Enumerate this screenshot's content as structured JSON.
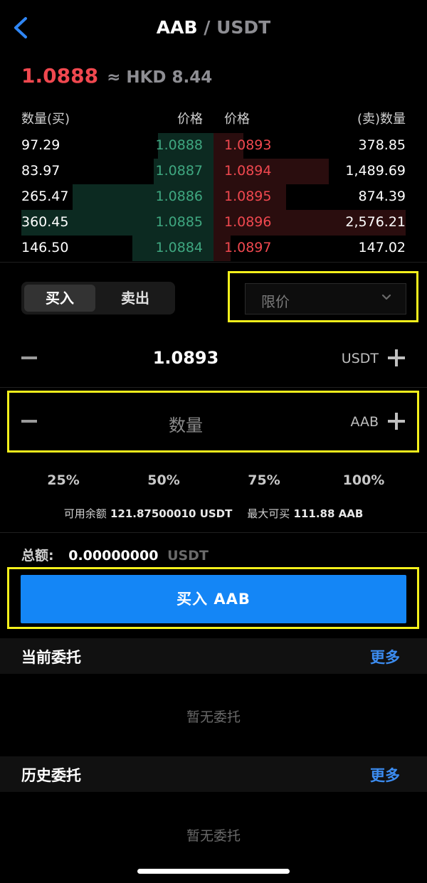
{
  "header": {
    "base": "AAB",
    "quote": "/ USDT"
  },
  "ticker": {
    "last_price": "1.0888",
    "approx": "≈ HKD 8.44"
  },
  "orderbook": {
    "headers": {
      "bid_qty": "数量(买)",
      "bid_price": "价格",
      "ask_price": "价格",
      "ask_qty": "(卖)数量"
    },
    "rows": [
      {
        "bid_qty": "97.29",
        "bid_price": "1.0888",
        "ask_price": "1.0893",
        "ask_qty": "378.85",
        "bid_depth": 0.13,
        "ask_depth": 0.07
      },
      {
        "bid_qty": "83.97",
        "bid_price": "1.0887",
        "ask_price": "1.0894",
        "ask_qty": "1,489.69",
        "bid_depth": 0.14,
        "ask_depth": 0.27
      },
      {
        "bid_qty": "265.47",
        "bid_price": "1.0886",
        "ask_price": "1.0895",
        "ask_qty": "874.39",
        "bid_depth": 0.33,
        "ask_depth": 0.17
      },
      {
        "bid_qty": "360.45",
        "bid_price": "1.0885",
        "ask_price": "1.0896",
        "ask_qty": "2,576.21",
        "bid_depth": 0.45,
        "ask_depth": 0.45
      },
      {
        "bid_qty": "146.50",
        "bid_price": "1.0884",
        "ask_price": "1.0897",
        "ask_qty": "147.02",
        "bid_depth": 0.19,
        "ask_depth": 0.04
      }
    ]
  },
  "trade": {
    "buy_tab": "买入",
    "sell_tab": "卖出",
    "order_type": "限价",
    "price_value": "1.0893",
    "price_unit": "USDT",
    "amount_placeholder": "数量",
    "amount_unit": "AAB",
    "percents": [
      "25%",
      "50%",
      "75%",
      "100%"
    ],
    "available_label": "可用余额",
    "available_value": "121.87500010 USDT",
    "max_buy_label": "最大可买",
    "max_buy_value": "111.88 AAB",
    "total_label": "总额:",
    "total_value": "0.00000000",
    "total_unit": "USDT",
    "submit_label": "买入 AAB"
  },
  "current_orders": {
    "title": "当前委托",
    "more": "更多",
    "empty": "暂无委托"
  },
  "history_orders": {
    "title": "历史委托",
    "more": "更多",
    "empty": "暂无委托"
  },
  "colors": {
    "bid": "#3fa780",
    "ask": "#f0484f",
    "accent": "#1486f6",
    "highlight": "#f4f01c"
  }
}
